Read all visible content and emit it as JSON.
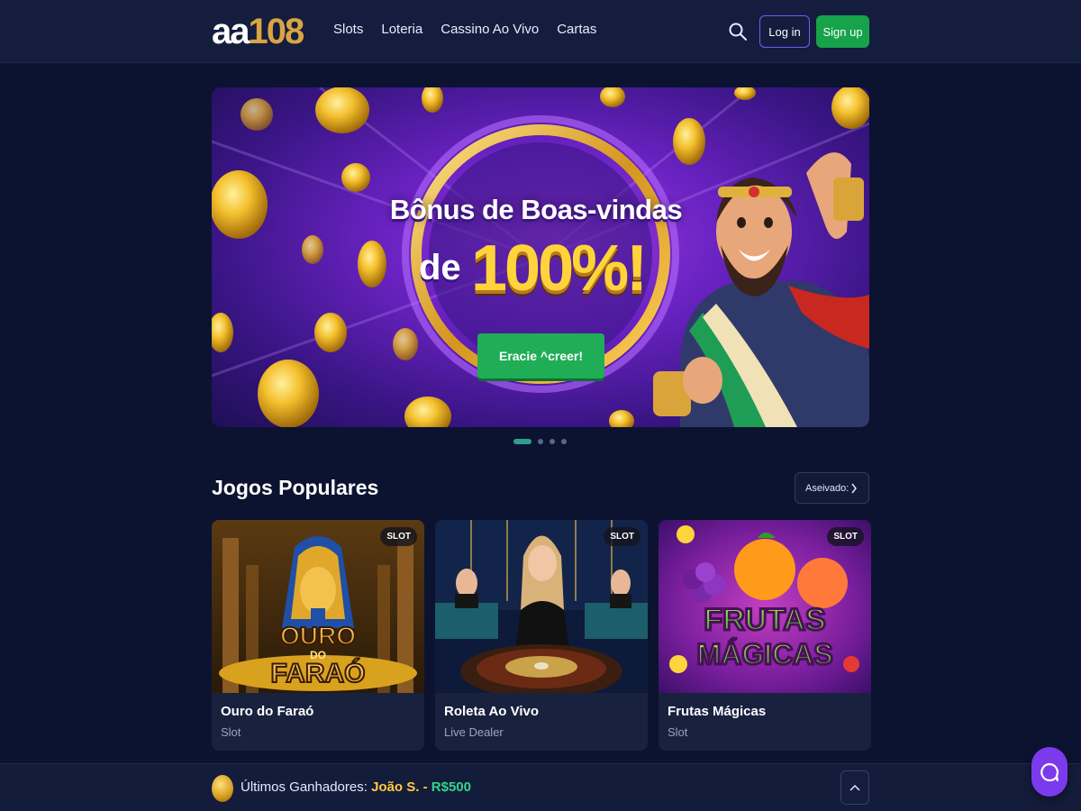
{
  "logo": {
    "left": "aa",
    "right": "108"
  },
  "nav": {
    "items": [
      "Slots",
      "Loteria",
      "Cassino Ao Vivo",
      "Cartas"
    ]
  },
  "header": {
    "login_label": "Log in",
    "signup_label": "Sign up"
  },
  "banner": {
    "title": "Bônus de Boas-vindas",
    "de": "de",
    "percent": "100%!",
    "cta": "Eracie ^creer!",
    "slide_count": 4,
    "active_slide": 1
  },
  "popular": {
    "title": "Jogos Populares",
    "see_all": "Aseivado:",
    "games": [
      {
        "title": "Ouro do Faraó",
        "category": "Slot",
        "badge": "SLOT",
        "art_text": [
          "OURO",
          "DO",
          "FARAÓ"
        ]
      },
      {
        "title": "Roleta Ao Vivo",
        "category": "Live Dealer",
        "badge": "SLOT"
      },
      {
        "title": "Frutas Mágicas",
        "category": "Slot",
        "badge": "SLOT",
        "art_text": [
          "FRUTAS",
          "MÁGICAS"
        ]
      }
    ]
  },
  "footer": {
    "label": "Últimos Ganhadores:",
    "winner": "João S.",
    "separator": "-",
    "amount": "R$500"
  },
  "colors": {
    "accent_green": "#16a34a",
    "accent_purple": "#7c3aed",
    "gold": "#ffd43b",
    "bg": "#0b1330"
  }
}
